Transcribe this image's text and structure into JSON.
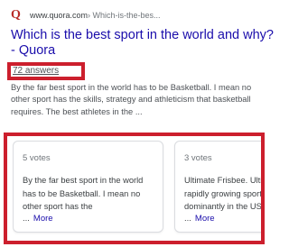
{
  "result": {
    "favicon": "Q",
    "domain": "www.quora.com",
    "path": " › Which-is-the-bes...",
    "title": "Which is the best sport in the world and why? - Quora",
    "answers_link": "72 answers",
    "snippet": "By the far best sport in the world has to be Basketball. I mean no other sport has the skills, strategy and athleticism that basketball requires. The best athletes in the ..."
  },
  "cards": [
    {
      "votes": "5 votes",
      "text": "By the far best sport in the world has to be Basketball. I mean no other sport has the",
      "ellipsis": "...",
      "more": "More"
    },
    {
      "votes": "3 votes",
      "text": "Ultimate Frisbee. Ultimate is a rapidly growing sport played dominantly in the US, but",
      "ellipsis": "...",
      "more": "More"
    }
  ],
  "colors": {
    "link": "#1a0dab",
    "highlight": "#cc1f2d",
    "quora_brand": "#b92b27"
  }
}
